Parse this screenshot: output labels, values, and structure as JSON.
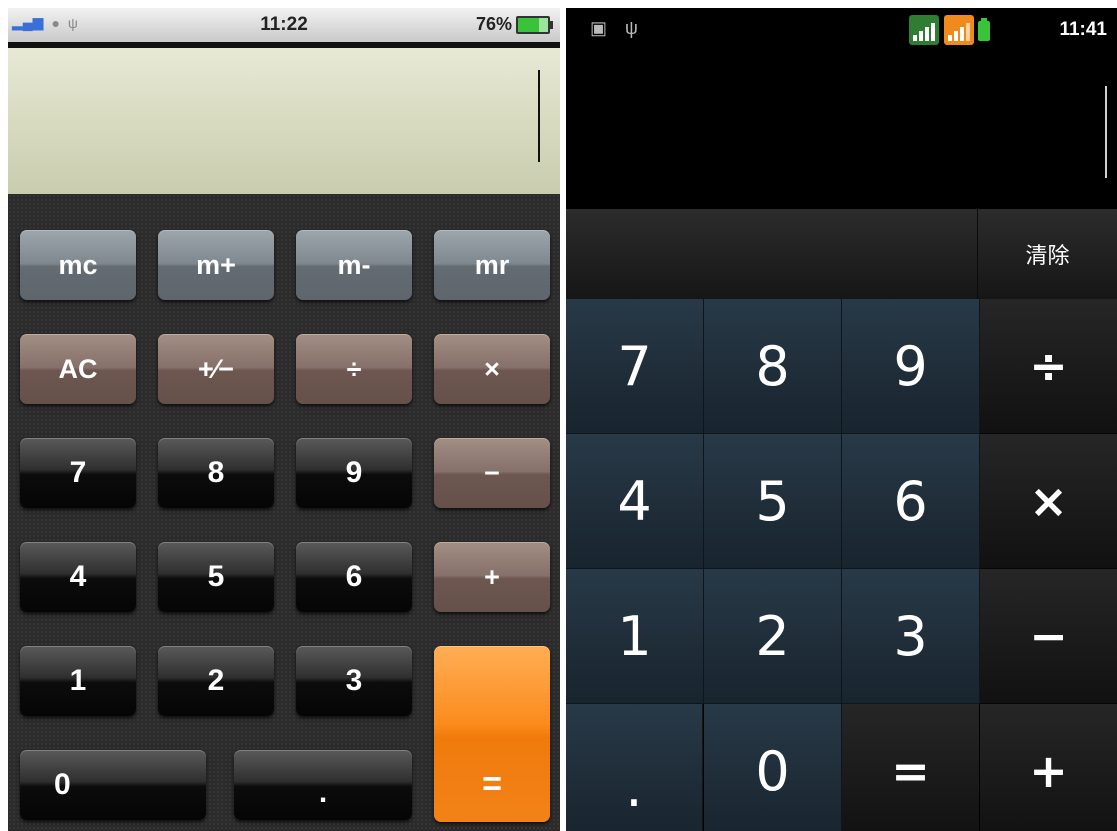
{
  "left_phone": {
    "status": {
      "time": "11:22",
      "battery": "76%"
    },
    "keys": {
      "mc": "mc",
      "mplus": "m+",
      "mminus": "m-",
      "mr": "mr",
      "ac": "AC",
      "plusminus": "+⁄−",
      "divide": "÷",
      "multiply": "×",
      "seven": "7",
      "eight": "8",
      "nine": "9",
      "minus": "−",
      "four": "4",
      "five": "5",
      "six": "6",
      "plus": "+",
      "one": "1",
      "two": "2",
      "three": "3",
      "equals": "=",
      "zero": "0",
      "decimal": "."
    }
  },
  "right_phone": {
    "status": {
      "time": "11:41"
    },
    "clear_label": "清除",
    "keys": {
      "seven": "7",
      "eight": "8",
      "nine": "9",
      "divide": "÷",
      "four": "4",
      "five": "5",
      "six": "6",
      "multiply": "×",
      "one": "1",
      "two": "2",
      "three": "3",
      "minus": "−",
      "decimal": ".",
      "zero": "0",
      "equals": "=",
      "plus": "+"
    }
  },
  "colors": {
    "equals_orange": "#f28218",
    "right_number_key": "#1f2f3b",
    "signal_green": "#2e7d32",
    "signal_orange": "#f08a1c"
  }
}
